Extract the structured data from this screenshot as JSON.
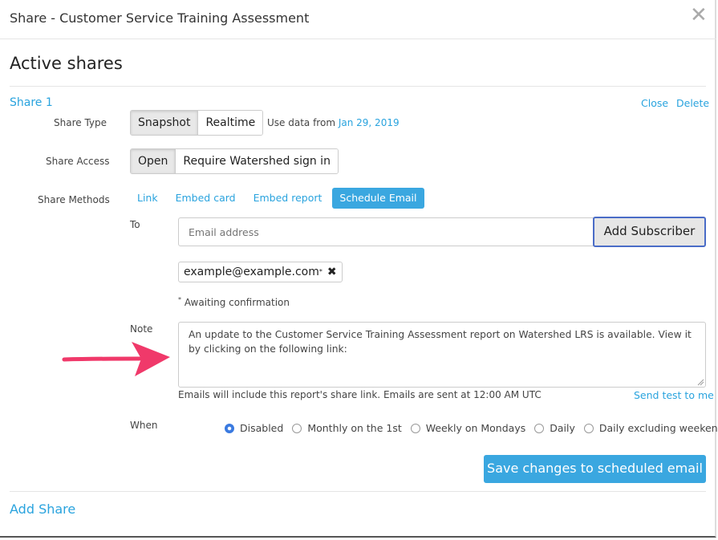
{
  "dialog": {
    "title": "Share - Customer Service Training Assessment",
    "close_glyph": "✕"
  },
  "section_title": "Active shares",
  "share": {
    "name": "Share 1",
    "close_label": "Close",
    "delete_label": "Delete",
    "type": {
      "label": "Share Type",
      "options": [
        "Snapshot",
        "Realtime"
      ],
      "selected": "Snapshot",
      "data_from_prefix": "Use data from",
      "data_from_date": "Jan 29, 2019"
    },
    "access": {
      "label": "Share Access",
      "options": [
        "Open",
        "Require Watershed sign in"
      ],
      "selected": "Open"
    },
    "methods": {
      "label": "Share Methods",
      "items": [
        "Link",
        "Embed card",
        "Embed report",
        "Schedule Email"
      ],
      "selected": "Schedule Email"
    },
    "email": {
      "to_label": "To",
      "placeholder": "Email address",
      "add_button": "Add Subscriber",
      "subscriber": "example@example.com",
      "subscriber_mark": "*",
      "remove_glyph": "✖",
      "awaiting_mark": "*",
      "awaiting_text": "Awaiting confirmation",
      "note_label": "Note",
      "note_text": "An update to the Customer Service Training Assessment report on Watershed LRS is available. View it by clicking on the following link:",
      "info_text": "Emails will include this report's share link. Emails are sent at 12:00 AM UTC",
      "send_test": "Send test to me",
      "when_label": "When",
      "schedule_options": [
        "Disabled",
        "Monthly on the 1st",
        "Weekly on Mondays",
        "Daily",
        "Daily excluding weekends"
      ],
      "schedule_selected": "Disabled",
      "save_button": "Save changes to scheduled email"
    }
  },
  "add_share": "Add Share",
  "colors": {
    "accent": "#3aa7e0",
    "link": "#29a3de",
    "arrow": "#f0396a"
  }
}
